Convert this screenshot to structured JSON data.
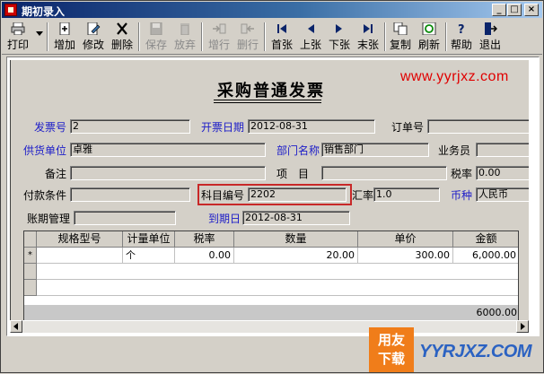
{
  "window": {
    "title": "期初录入",
    "minimize": "_",
    "maximize": "□",
    "close": "×"
  },
  "toolbar": {
    "items": [
      {
        "label": "打印",
        "icon": "printer-icon",
        "enabled": true
      },
      {
        "label": "增加",
        "icon": "add-document-icon",
        "enabled": true
      },
      {
        "label": "修改",
        "icon": "edit-icon",
        "enabled": true
      },
      {
        "label": "删除",
        "icon": "delete-icon",
        "enabled": true
      },
      {
        "label": "保存",
        "icon": "save-icon",
        "enabled": false
      },
      {
        "label": "放弃",
        "icon": "discard-icon",
        "enabled": false
      },
      {
        "label": "增行",
        "icon": "add-row-icon",
        "enabled": false
      },
      {
        "label": "删行",
        "icon": "delete-row-icon",
        "enabled": false
      },
      {
        "label": "首张",
        "icon": "first-record-icon",
        "enabled": true
      },
      {
        "label": "上张",
        "icon": "previous-record-icon",
        "enabled": true
      },
      {
        "label": "下张",
        "icon": "next-record-icon",
        "enabled": true
      },
      {
        "label": "末张",
        "icon": "last-record-icon",
        "enabled": true
      },
      {
        "label": "复制",
        "icon": "copy-icon",
        "enabled": true
      },
      {
        "label": "刷新",
        "icon": "refresh-icon",
        "enabled": true
      },
      {
        "label": "帮助",
        "icon": "help-icon",
        "enabled": true
      },
      {
        "label": "退出",
        "icon": "exit-icon",
        "enabled": true
      }
    ]
  },
  "form": {
    "title": "采购普通发票",
    "watermark": "www.yyrjxz.com",
    "fields": {
      "invoice_no": {
        "label": "发票号",
        "value": "2"
      },
      "invoice_date": {
        "label": "开票日期",
        "value": "2012-08-31"
      },
      "order_no": {
        "label": "订单号",
        "value": ""
      },
      "supplier": {
        "label": "供货单位",
        "value": "卓雅"
      },
      "department": {
        "label": "部门名称",
        "value": "销售部门"
      },
      "salesperson": {
        "label": "业务员",
        "value": ""
      },
      "remarks": {
        "label": "备注",
        "value": ""
      },
      "project": {
        "label": "项　目",
        "value": ""
      },
      "tax_rate": {
        "label": "税率",
        "value": "0.00"
      },
      "payment_terms": {
        "label": "付款条件",
        "value": ""
      },
      "account_code": {
        "label": "科目编号",
        "value": "2202"
      },
      "exchange_rate": {
        "label": "汇率",
        "value": "1.0"
      },
      "currency": {
        "label": "币种",
        "value": "人民币"
      },
      "period_mgmt": {
        "label": "账期管理",
        "value": ""
      },
      "due_date": {
        "label": "到期日",
        "value": "2012-08-31"
      }
    }
  },
  "grid": {
    "columns": [
      "规格型号",
      "计量单位",
      "税率",
      "数量",
      "单价",
      "金额"
    ],
    "rows": [
      {
        "marker": "*",
        "spec": "",
        "unit": "个",
        "tax_rate": "0.00",
        "quantity": "20.00",
        "price": "300.00",
        "amount": "6,000.00"
      }
    ],
    "total_amount": "6000.00"
  },
  "colors": {
    "label_blue": "#1c1cc8",
    "highlight_red": "#c82828",
    "watermark_red": "#e00000",
    "logo_orange": "#f07d1a",
    "logo_blue": "#2b62c2"
  },
  "logo": {
    "box_line1": "用友",
    "box_line2": "下载",
    "text": "YYRJXZ.COM"
  }
}
